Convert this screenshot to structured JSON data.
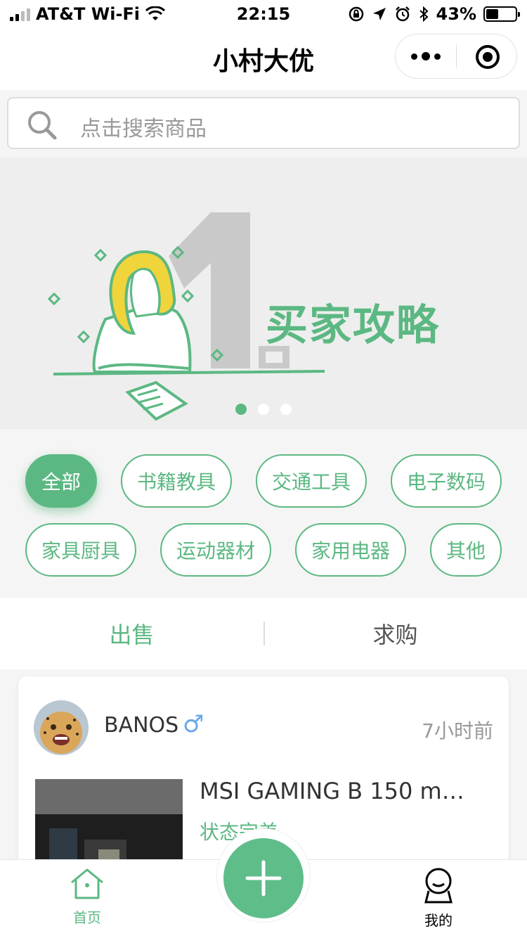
{
  "status_bar": {
    "carrier": "AT&T Wi-Fi",
    "time": "22:15",
    "battery": "43%",
    "battery_level": 0.43
  },
  "nav": {
    "title": "小村大优"
  },
  "search": {
    "placeholder": "点击搜索商品"
  },
  "banner": {
    "title": "买家攻略",
    "slide_count": 3,
    "active_slide": 1
  },
  "categories": [
    {
      "label": "全部",
      "active": true
    },
    {
      "label": "书籍教具",
      "active": false
    },
    {
      "label": "交通工具",
      "active": false
    },
    {
      "label": "电子数码",
      "active": false
    },
    {
      "label": "家具厨具",
      "active": false
    },
    {
      "label": "运动器材",
      "active": false
    },
    {
      "label": "家用电器",
      "active": false
    },
    {
      "label": "其他",
      "active": false
    }
  ],
  "tabs": {
    "sell": "出售",
    "buy": "求购",
    "active": "sell"
  },
  "post": {
    "username": "BANOS",
    "gender_symbol": "♂",
    "time": "7小时前",
    "title": "MSI GAMING B 150 m…",
    "status": "状态完美"
  },
  "tabbar": {
    "home": "首页",
    "mine": "我的"
  },
  "colors": {
    "accent": "#5cb882",
    "gender": "#6aa7e8"
  }
}
